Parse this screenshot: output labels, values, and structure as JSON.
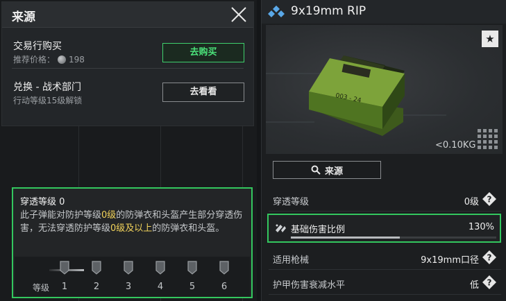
{
  "source_panel": {
    "title": "来源",
    "rows": [
      {
        "title": "交易行购买",
        "sub_prefix": "推荐价格：",
        "sub_value": "198",
        "button": "去购买"
      },
      {
        "title": "兑换 - 战术部门",
        "sub": "行动等级15级解锁",
        "button": "去看看"
      }
    ]
  },
  "penetration": {
    "title": "穿透等级 0",
    "desc_parts": [
      "此子弹能对防护等级",
      "0级",
      "的防弹衣和头盔产生部分穿透伤害，无法穿透防护等级",
      "0级及以上",
      "的防弹衣和头盔。"
    ],
    "level_label": "等级",
    "levels": [
      "1",
      "2",
      "3",
      "4",
      "5",
      "6"
    ],
    "current_level": 0
  },
  "item": {
    "name": "9x19mm RIP",
    "weight": "<0.10KG",
    "source_button": "来源",
    "stats": [
      {
        "label": "穿透等级",
        "value": "0级"
      },
      {
        "label": "适用枪械",
        "value": "9x19mm口径"
      },
      {
        "label": "护甲伤害衰减水平",
        "value": "低"
      }
    ],
    "damage": {
      "label": "基础伤害比例",
      "value": "130%",
      "fill_fraction": 0.53
    }
  },
  "colors": {
    "accent_green": "#33c75e",
    "highlight_yellow": "#f2d35b",
    "rarity_blue": "#5aa8e8"
  }
}
